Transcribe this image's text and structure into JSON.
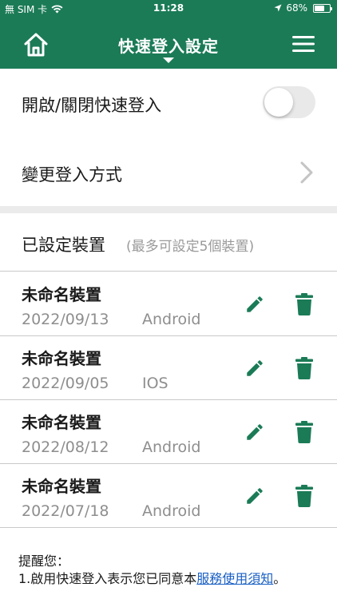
{
  "status_bar": {
    "carrier": "無 SIM 卡",
    "time": "11:28",
    "battery_percent": "68%",
    "battery_level": 0.68
  },
  "nav": {
    "title": "快速登入設定",
    "home_icon": "home-icon",
    "menu_icon": "hamburger-menu-icon"
  },
  "settings": {
    "toggle_label": "開啟/關閉快速登入",
    "toggle_on": false,
    "change_login_label": "變更登入方式"
  },
  "devices_section": {
    "title": "已設定裝置",
    "note": "(最多可設定5個裝置)"
  },
  "devices": [
    {
      "name": "未命名裝置",
      "date": "2022/09/13",
      "os": "Android"
    },
    {
      "name": "未命名裝置",
      "date": "2022/09/05",
      "os": "IOS"
    },
    {
      "name": "未命名裝置",
      "date": "2022/08/12",
      "os": "Android"
    },
    {
      "name": "未命名裝置",
      "date": "2022/07/18",
      "os": "Android"
    }
  ],
  "reminder": {
    "heading": "提醒您：",
    "line1_prefix": "1.啟用快速登入表示您已同意本",
    "line1_link": "服務使用須知",
    "line1_suffix": "。"
  },
  "colors": {
    "brand_green": "#1b7b57",
    "action_green": "#1b7b57",
    "link_blue": "#1a5fc4"
  }
}
